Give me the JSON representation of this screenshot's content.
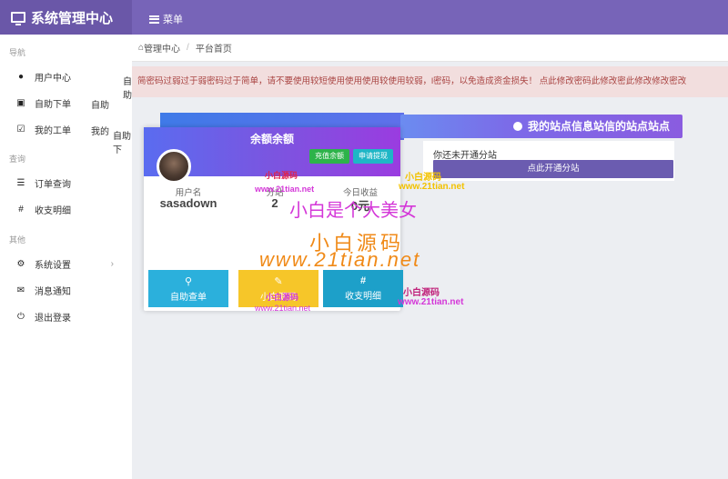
{
  "header": {
    "app_title": "系统管理中心",
    "menu_label": "菜单"
  },
  "sidebar": {
    "sections": [
      {
        "title": "导航"
      },
      {
        "title": "查询"
      },
      {
        "title": "其他"
      }
    ],
    "items": [
      {
        "label": "用户中心",
        "icon": "user-icon"
      },
      {
        "label": "自助下单",
        "icon": "cart-icon"
      },
      {
        "label": "我的工单",
        "icon": "check-square-icon"
      },
      {
        "label": "订单查询",
        "icon": "list-icon"
      },
      {
        "label": "收支明细",
        "icon": "hash-icon"
      },
      {
        "label": "系统设置",
        "icon": "settings-icon"
      },
      {
        "label": "消息通知",
        "icon": "megaphone-icon"
      },
      {
        "label": "退出登录",
        "icon": "power-icon"
      }
    ],
    "overlaps": {
      "a": "自助",
      "b": "自助下单",
      "c": "我的",
      "d": "自助下"
    }
  },
  "breadcrumb": {
    "home": "管理中心",
    "current": "平台首页"
  },
  "alert": {
    "text": "简密码过弱过于弱密码过于简单，请不要使用较短使用使用使用较使用较弱，l密码，以免造成资金损失！ 点此修改密码此修改密此修改修改密改"
  },
  "profile": {
    "balance_title": "余额余额",
    "recharge_button": "充值余额",
    "withdraw_button": "申请提现",
    "stats": [
      {
        "label": "用户名",
        "value": "sasadown"
      },
      {
        "label": "分站",
        "value": "2"
      },
      {
        "label": "今日收益",
        "value": "0元"
      }
    ]
  },
  "actions": [
    {
      "label": "自助查单",
      "icon": "search-icon",
      "color": "#2bb0dc"
    },
    {
      "label": "小白源码",
      "icon": "edit-icon",
      "color": "#f6c629"
    },
    {
      "label": "收支明细",
      "icon": "hash-icon",
      "color": "#1da0c9"
    }
  ],
  "site": {
    "ribbon_title": "我的站点信息站信的站点站点",
    "no_subsite": "你还未开通分站",
    "open_subsite_button": "点此开通分站"
  },
  "watermarks": {
    "line1": "小白是个大美女",
    "line2": "小白源码",
    "line3": "www.21tian.net",
    "small1": "小白源码",
    "small2": "www.21tian.net",
    "small3": "小白源码",
    "small4": "www.21tian.net",
    "small5": "小白源码",
    "small6": "www.21tian.net",
    "small7": "小白源码",
    "small8": "www.21tian.net"
  },
  "colors": {
    "topbar": "#7764b8",
    "primary": "#6b5cb0",
    "alert_bg": "#f2dede",
    "alert_text": "#a94442"
  }
}
